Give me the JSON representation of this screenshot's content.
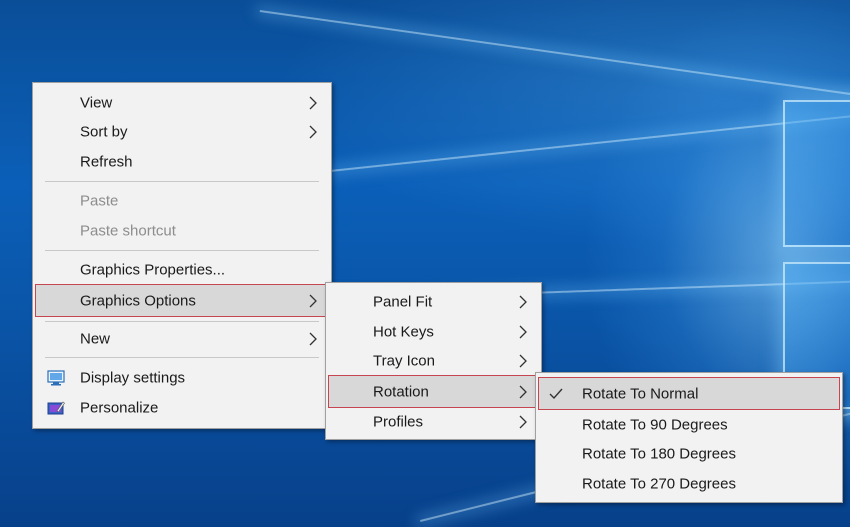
{
  "context_menu": {
    "items": [
      {
        "label": "View",
        "has_submenu": true
      },
      {
        "label": "Sort by",
        "has_submenu": true
      },
      {
        "label": "Refresh"
      },
      {
        "label": "Paste",
        "disabled": true
      },
      {
        "label": "Paste shortcut",
        "disabled": true
      },
      {
        "label": "Graphics Properties..."
      },
      {
        "label": "Graphics Options",
        "has_submenu": true,
        "highlighted": true
      },
      {
        "label": "New",
        "has_submenu": true
      },
      {
        "label": "Display settings",
        "icon": "display-settings-icon"
      },
      {
        "label": "Personalize",
        "icon": "personalize-icon"
      }
    ]
  },
  "graphics_options_submenu": {
    "items": [
      {
        "label": "Panel Fit",
        "has_submenu": true
      },
      {
        "label": "Hot Keys",
        "has_submenu": true
      },
      {
        "label": "Tray Icon",
        "has_submenu": true
      },
      {
        "label": "Rotation",
        "has_submenu": true,
        "highlighted": true
      },
      {
        "label": "Profiles",
        "has_submenu": true
      }
    ]
  },
  "rotation_submenu": {
    "items": [
      {
        "label": "Rotate To Normal",
        "checked": true,
        "highlighted": true
      },
      {
        "label": "Rotate To 90 Degrees"
      },
      {
        "label": "Rotate To 180 Degrees"
      },
      {
        "label": "Rotate To 270 Degrees"
      }
    ]
  },
  "colors": {
    "menu_background": "#f2f2f2",
    "highlight_background": "#d8d8d8",
    "highlight_border": "#c54650",
    "disabled_text": "#8d8d8d",
    "wallpaper_blue": "#0b5fb8"
  }
}
